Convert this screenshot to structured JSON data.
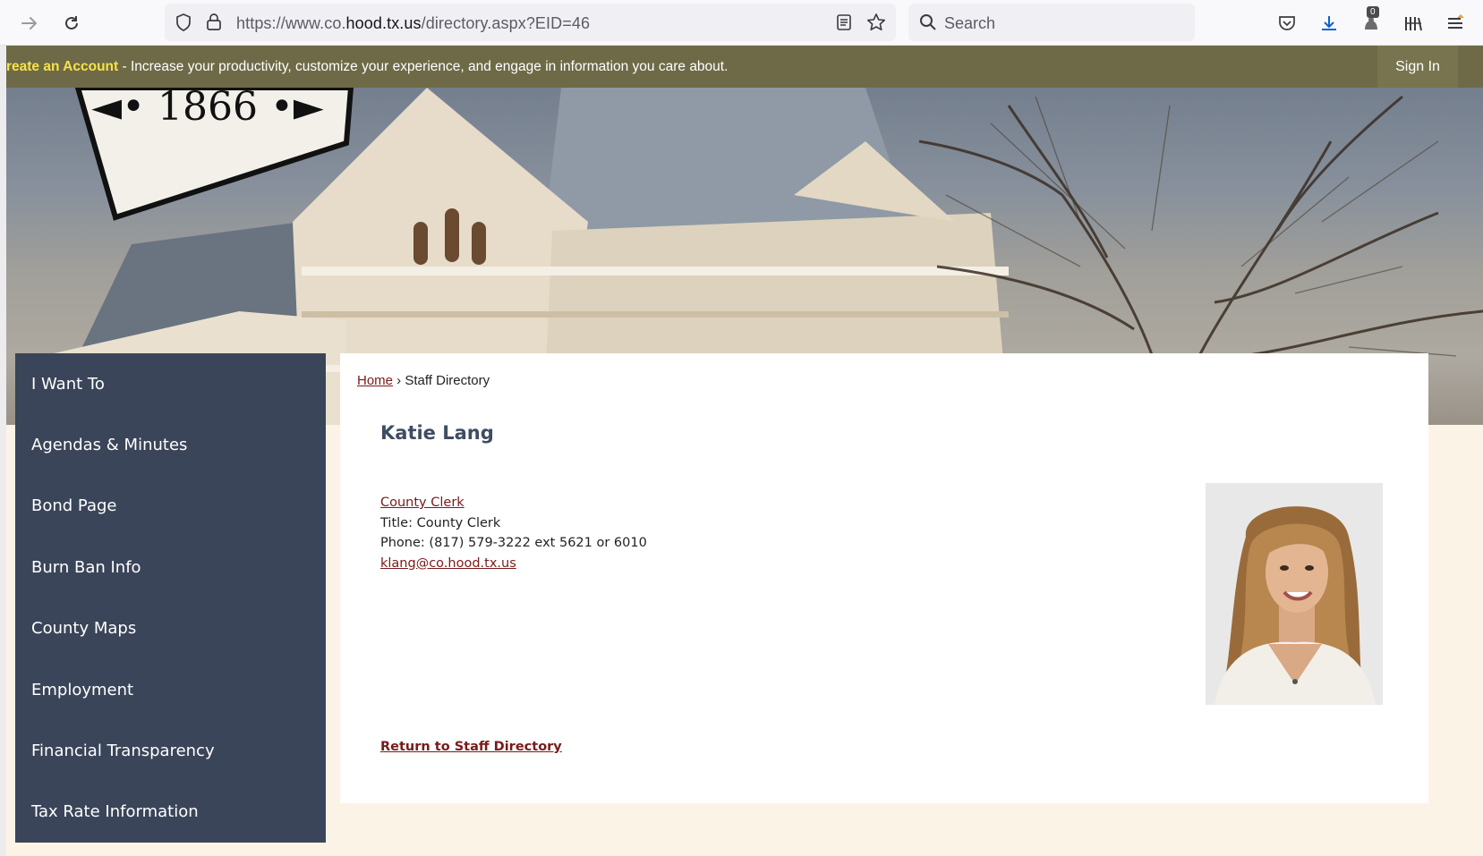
{
  "browser": {
    "url_scheme": "https://www.co.",
    "url_host": "hood.tx.us",
    "url_path": "/directory.aspx?EID=46",
    "search_placeholder": "Search",
    "badge_count": "0"
  },
  "account_bar": {
    "link_text": "reate an Account",
    "message": " - Increase your productivity, customize your experience, and engage in information you care about.",
    "sign_in": "Sign In"
  },
  "banner": {
    "seal_year": "◄• 1866 •►"
  },
  "sidebar": {
    "items": [
      {
        "label": "I Want To"
      },
      {
        "label": "Agendas & Minutes"
      },
      {
        "label": "Bond Page"
      },
      {
        "label": "Burn Ban Info"
      },
      {
        "label": "County Maps"
      },
      {
        "label": "Employment"
      },
      {
        "label": "Financial Transparency"
      },
      {
        "label": "Tax Rate Information"
      }
    ]
  },
  "breadcrumb": {
    "home": "Home",
    "separator": " › ",
    "current": "Staff Directory"
  },
  "staff": {
    "name": "Katie Lang",
    "department": "County Clerk",
    "title": "Title: County Clerk",
    "phone": "Phone: (817) 579-3222 ext 5621 or 6010",
    "email": "klang@co.hood.tx.us"
  },
  "return_link": "Return to Staff Directory",
  "colors": {
    "account_bar": "#6e6a47",
    "sidebar": "#3a4559",
    "link": "#7a1a1a",
    "heading": "#3f4d63",
    "page_bg": "#fbf4e6"
  }
}
